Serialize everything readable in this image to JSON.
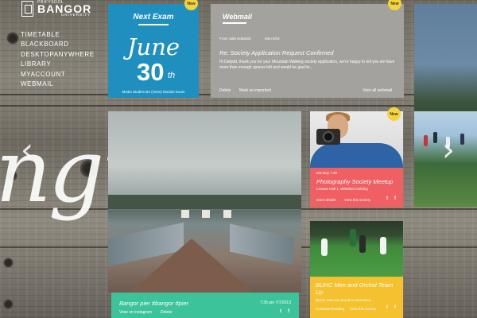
{
  "logo": {
    "line1": "PRIFYSGOL",
    "line2": "BANGOR",
    "line3": "UNIVERSITY"
  },
  "nav": [
    "TIMETABLE",
    "BLACKBOARD",
    "DESKTOPANYWHERE",
    "LIBRARY",
    "MYACCOUNT",
    "WEBMAIL"
  ],
  "background_text": "ngu",
  "badges": {
    "new": "New"
  },
  "exam": {
    "heading": "Next Exam",
    "month": "June",
    "day": "30",
    "suffix": "th",
    "subject": "Media Studies BA (Hons) Module Exam"
  },
  "webmail": {
    "heading": "Webmail",
    "from": "From Julie Edwards",
    "date": "Mon 6/22",
    "subject": "Re: Society Application Request Confirmed",
    "body": "Hi Dafydd, thank you for your Mountain Walking society application, we're happy to tell you we have more than enough spaces left and would be glad to...",
    "delete_label": "Delete",
    "mark_label": "Mark as important",
    "view_all_label": "View all webmail"
  },
  "pier_post": {
    "title": "Bangor pier #bangor #pier",
    "time": "7:35 pm 7/7/2013",
    "view_label": "View on instagram",
    "delete_label": "Delete"
  },
  "event": {
    "date": "Monday 7:30",
    "title": "Photography Society Meetup",
    "location": "Lecture Hall 1, Wheldon building",
    "more_label": "More details",
    "view_label": "View this society"
  },
  "sport": {
    "title": "BUHC Men and Orchid Team Up",
    "body": "BUHC Men are proud to announce...",
    "continue_label": "Continue Reading",
    "view_label": "View this society"
  },
  "icons": {
    "prev": "chevron-left-icon",
    "next": "chevron-right-icon",
    "twitter": "twitter-icon",
    "facebook": "facebook-icon"
  },
  "colors": {
    "exam_blue": "#1e8fbf",
    "webmail_grey": "#a4a29f",
    "instagram_green": "#3cc39a",
    "event_red": "#ef5f63",
    "sport_yellow": "#f6c12e",
    "badge_yellow": "#f5d33a"
  }
}
